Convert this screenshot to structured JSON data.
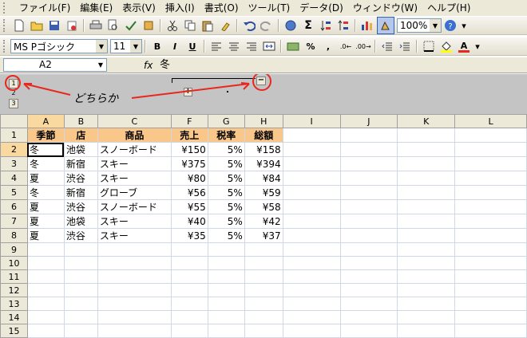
{
  "menubar": {
    "items": [
      "ファイル(F)",
      "編集(E)",
      "表示(V)",
      "挿入(I)",
      "書式(O)",
      "ツール(T)",
      "データ(D)",
      "ウィンドウ(W)",
      "ヘルプ(H)"
    ]
  },
  "toolbar": {
    "zoom": "100%"
  },
  "formatbar": {
    "font": "MS Pゴシック",
    "size": "11",
    "bold": "B",
    "italic": "I",
    "underline": "U",
    "font_color_letter": "A"
  },
  "formula_bar": {
    "name_box": "A2",
    "fx": "fx",
    "content": "冬"
  },
  "outline": {
    "levels": [
      "1",
      "2",
      "3"
    ],
    "collapse_symbol": "−",
    "expand_symbol": "+",
    "annotation": "どちらか"
  },
  "colors": {
    "header_fill": "#f9c78a",
    "annotation": "#e8281e"
  },
  "grid": {
    "columns": [
      "A",
      "B",
      "C",
      "F",
      "G",
      "H",
      "I",
      "J",
      "K",
      "L"
    ],
    "row_numbers": [
      "1",
      "2",
      "3",
      "4",
      "5",
      "6",
      "7",
      "8",
      "9",
      "10",
      "11",
      "12",
      "13",
      "14",
      "15"
    ],
    "header": [
      "季節",
      "店",
      "商品",
      "売上",
      "税率",
      "総額"
    ],
    "rows": [
      [
        "冬",
        "池袋",
        "スノーボード",
        "¥150",
        "5%",
        "¥158"
      ],
      [
        "冬",
        "新宿",
        "スキー",
        "¥375",
        "5%",
        "¥394"
      ],
      [
        "夏",
        "渋谷",
        "スキー",
        "¥80",
        "5%",
        "¥84"
      ],
      [
        "冬",
        "新宿",
        "グローブ",
        "¥56",
        "5%",
        "¥59"
      ],
      [
        "夏",
        "渋谷",
        "スノーボード",
        "¥55",
        "5%",
        "¥58"
      ],
      [
        "夏",
        "池袋",
        "スキー",
        "¥40",
        "5%",
        "¥42"
      ],
      [
        "夏",
        "渋谷",
        "スキー",
        "¥35",
        "5%",
        "¥37"
      ]
    ]
  }
}
